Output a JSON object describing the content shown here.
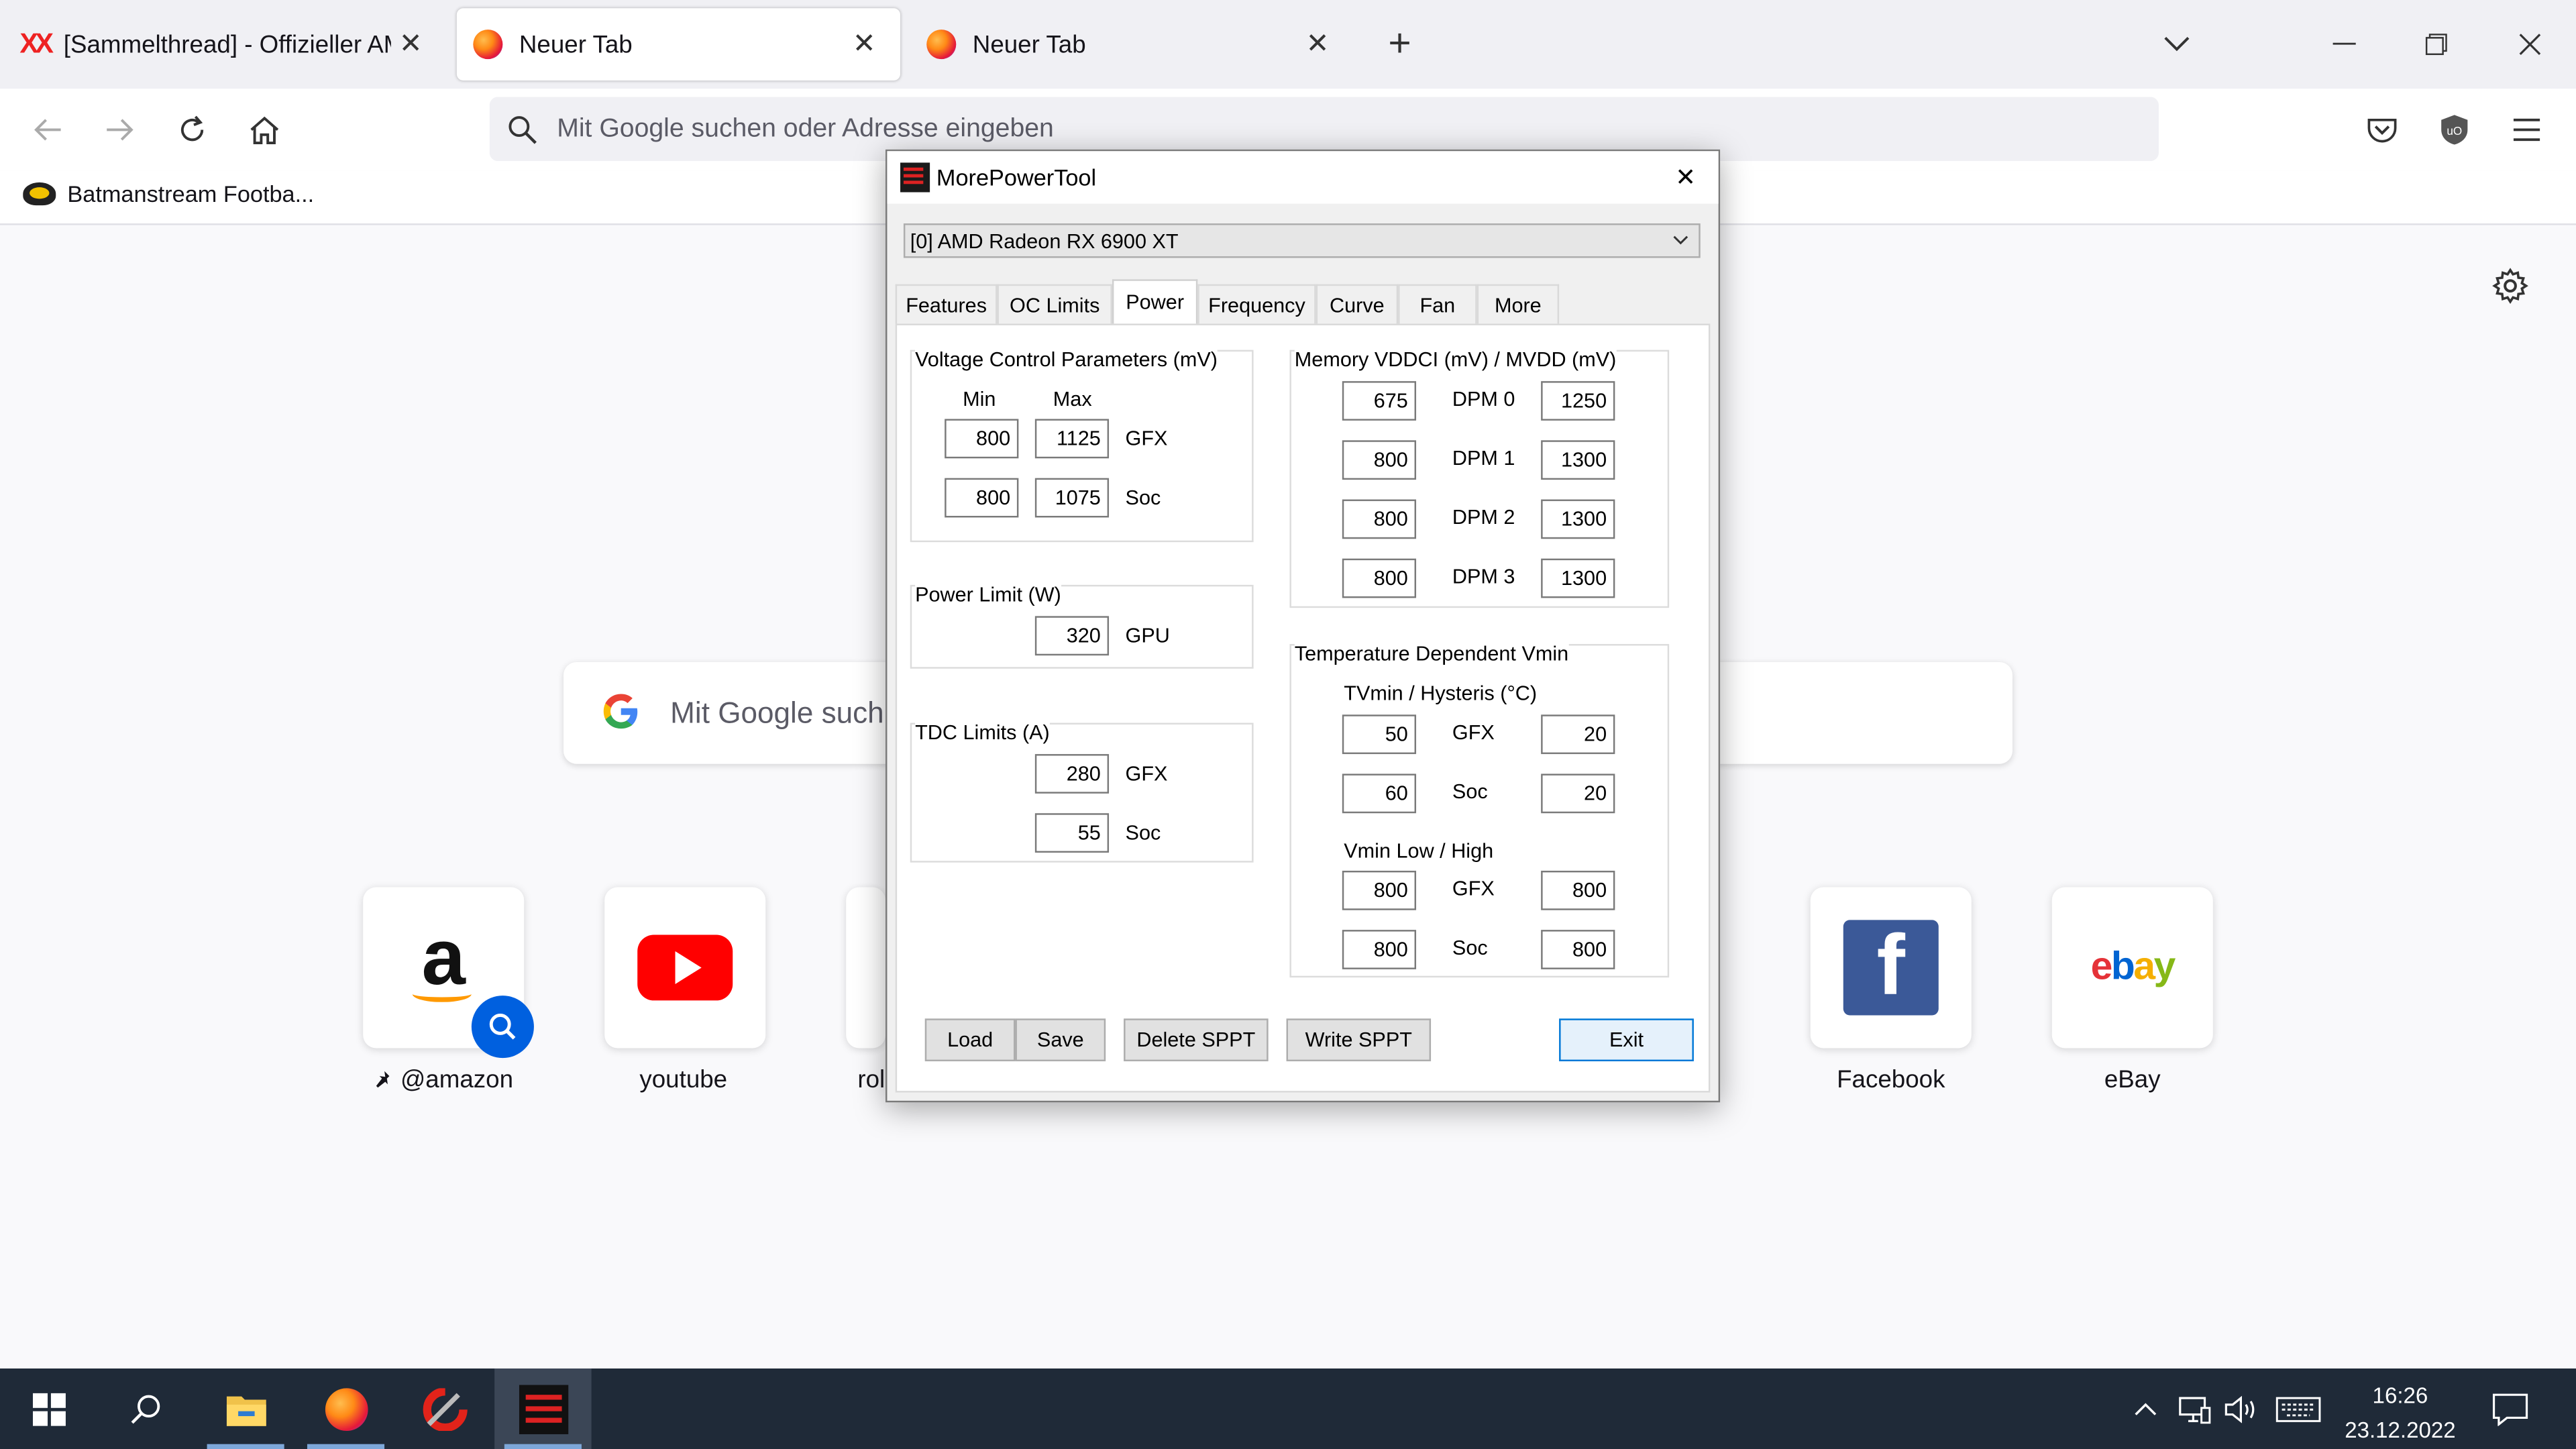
{
  "browser": {
    "tabs": [
      {
        "title": "[Sammelthread] - Offizieller AM"
      },
      {
        "title": "Neuer Tab"
      },
      {
        "title": "Neuer Tab"
      }
    ],
    "url_placeholder": "Mit Google suchen oder Adresse eingeben",
    "bookmark": "Batmanstream Footba..."
  },
  "newtab": {
    "search_placeholder": "Mit Google such",
    "tiles": [
      {
        "label": "@amazon"
      },
      {
        "label": "youtube"
      },
      {
        "label": "rol"
      },
      {
        "label": "Facebook"
      },
      {
        "label": "eBay"
      }
    ],
    "ebay_letters": [
      "e",
      "b",
      "a",
      "y"
    ],
    "colors": {
      "ebay": [
        "#e53238",
        "#0064d2",
        "#f5af02",
        "#86b817"
      ],
      "youtube": "#ff0000",
      "facebook": "#3b5998",
      "amazon_smile": "#ff9900"
    }
  },
  "mpt": {
    "title": "MorePowerTool",
    "gpu": "[0] AMD Radeon RX 6900 XT",
    "tabs": [
      "Features",
      "OC Limits",
      "Power",
      "Frequency",
      "Curve",
      "Fan",
      "More"
    ],
    "active_tab": "Power",
    "voltage": {
      "title": "Voltage Control Parameters (mV)",
      "min_label": "Min",
      "max_label": "Max",
      "rows": [
        {
          "min": "800",
          "max": "1125",
          "name": "GFX"
        },
        {
          "min": "800",
          "max": "1075",
          "name": "Soc"
        }
      ]
    },
    "power_limit": {
      "title": "Power Limit (W)",
      "value": "320",
      "name": "GPU"
    },
    "tdc": {
      "title": "TDC Limits (A)",
      "rows": [
        {
          "value": "280",
          "name": "GFX"
        },
        {
          "value": "55",
          "name": "Soc"
        }
      ]
    },
    "memory": {
      "title": "Memory VDDCI (mV) / MVDD (mV)",
      "rows": [
        {
          "vddci": "675",
          "name": "DPM 0",
          "mvdd": "1250"
        },
        {
          "vddci": "800",
          "name": "DPM 1",
          "mvdd": "1300"
        },
        {
          "vddci": "800",
          "name": "DPM 2",
          "mvdd": "1300"
        },
        {
          "vddci": "800",
          "name": "DPM 3",
          "mvdd": "1300"
        }
      ]
    },
    "temp_vmin": {
      "title": "Temperature Dependent Vmin",
      "tvmin_title": "TVmin / Hysteris (°C)",
      "tvmin_rows": [
        {
          "a": "50",
          "name": "GFX",
          "b": "20"
        },
        {
          "a": "60",
          "name": "Soc",
          "b": "20"
        }
      ],
      "vmin_title": "Vmin Low / High",
      "vmin_rows": [
        {
          "a": "800",
          "name": "GFX",
          "b": "800"
        },
        {
          "a": "800",
          "name": "Soc",
          "b": "800"
        }
      ]
    },
    "buttons": {
      "load": "Load",
      "save": "Save",
      "delete": "Delete SPPT",
      "write": "Write SPPT",
      "exit": "Exit"
    }
  },
  "taskbar": {
    "time": "16:26",
    "date": "23.12.2022"
  }
}
